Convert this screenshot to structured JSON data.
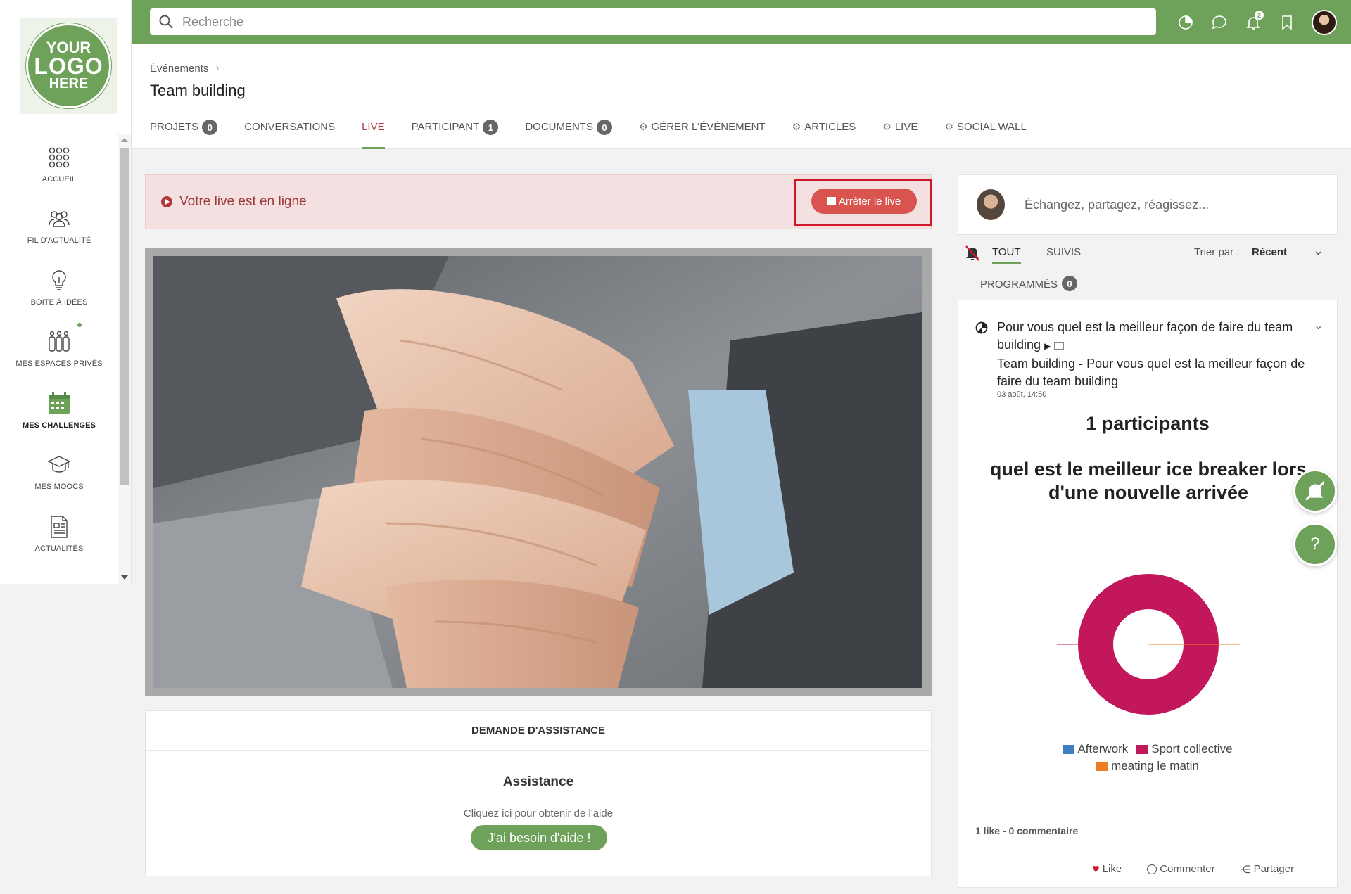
{
  "logo": {
    "line1": "YOUR",
    "line2": "LOGO",
    "line3": "HERE"
  },
  "search": {
    "placeholder": "Recherche"
  },
  "topbar": {
    "notification_count": "2"
  },
  "sidebar": {
    "items": [
      {
        "label": "ACCUEIL",
        "icon": "grid-dots-icon"
      },
      {
        "label": "FIL D'ACTUALITÉ",
        "icon": "people-group-icon"
      },
      {
        "label": "BOITE À IDÉES",
        "icon": "lightbulb-icon"
      },
      {
        "label": "MES ESPACES PRIVÉS",
        "icon": "private-space-icon"
      },
      {
        "label": "MES CHALLENGES",
        "icon": "calendar-icon"
      },
      {
        "label": "MES MOOCS",
        "icon": "graduation-cap-icon"
      },
      {
        "label": "ACTUALITÉS",
        "icon": "newspaper-icon"
      }
    ]
  },
  "header": {
    "breadcrumb": "Événements",
    "title": "Team building",
    "tabs": [
      {
        "label": "PROJETS",
        "badge": "0"
      },
      {
        "label": "CONVERSATIONS"
      },
      {
        "label": "LIVE"
      },
      {
        "label": "PARTICIPANT",
        "badge": "1"
      },
      {
        "label": "DOCUMENTS",
        "badge": "0"
      },
      {
        "label": "GÉRER L'ÉVÉNEMENT"
      },
      {
        "label": "ARTICLES"
      },
      {
        "label": "LIVE"
      },
      {
        "label": "SOCIAL WALL"
      }
    ]
  },
  "live": {
    "status": "Votre live est en ligne",
    "stop_label": "Arrêter le live"
  },
  "assistance": {
    "heading": "DEMANDE D'ASSISTANCE",
    "title": "Assistance",
    "subtitle": "Cliquez ici pour obtenir de l'aide",
    "button": "J'ai besoin d'aide !"
  },
  "feed": {
    "compose_placeholder": "Échangez, partagez, réagissez...",
    "tab_all": "TOUT",
    "tab_followed": "SUIVIS",
    "tab_scheduled": "PROGRAMMÉS",
    "scheduled_count": "0",
    "sort_label": "Trier par :",
    "sort_value": "Récent"
  },
  "post": {
    "title": "Pour vous quel est la meilleur façon de faire du team building",
    "body": "Team building - Pour vous quel est la meilleur façon de faire du team building",
    "date": "03 août, 14:50",
    "participants": "1 participants",
    "question": "quel est le meilleur ice breaker lors d'une nouvelle arrivée",
    "stats": "1 like - 0 commentaire",
    "like": "Like",
    "comment": "Commenter",
    "share": "Partager"
  },
  "chart_data": {
    "type": "pie",
    "categories": [
      "Afterwork",
      "Sport collective",
      "meating le matin"
    ],
    "values": [
      0,
      1,
      0
    ],
    "colors": [
      "#3d7ec0",
      "#c2185b",
      "#ef7d22"
    ],
    "legend": "bottom"
  },
  "fab": {
    "help": "?"
  }
}
